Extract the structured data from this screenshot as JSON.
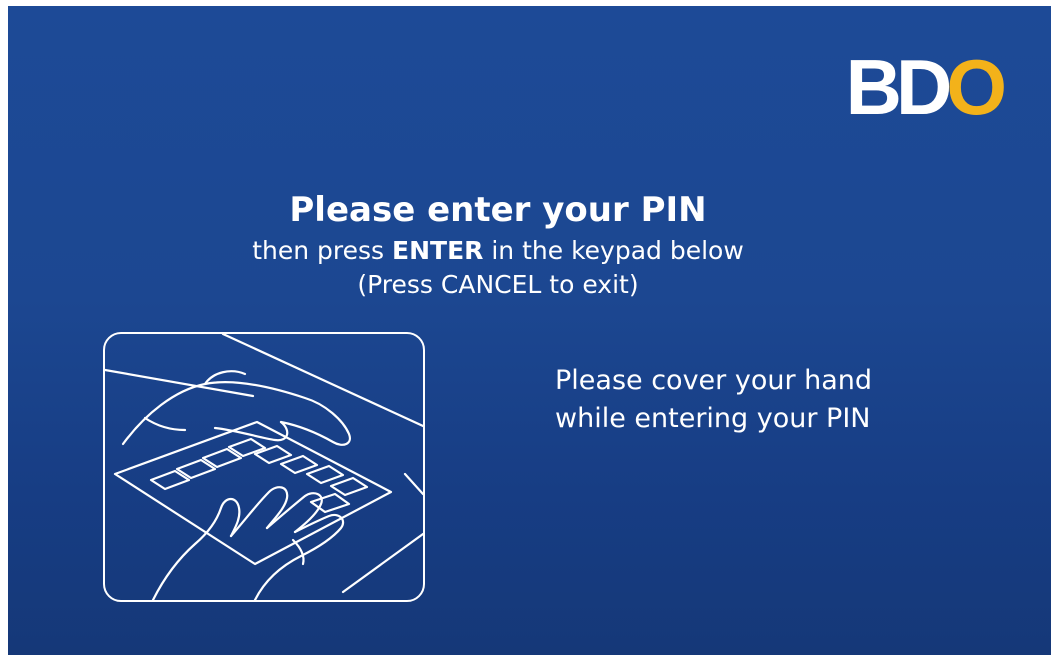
{
  "brand": {
    "logo_text_main": "BD",
    "logo_text_accent": "O",
    "primary_color": "#1c4791",
    "accent_color": "#f3b21a"
  },
  "prompt": {
    "title": "Please enter your PIN",
    "subtitle_pre": "then press ",
    "subtitle_key": "ENTER",
    "subtitle_post": " in the keypad below",
    "cancel_hint": "(Press CANCEL to exit)"
  },
  "security_note": {
    "line1": "Please cover your hand",
    "line2": "while entering your PIN",
    "icon": "hand-covering-keypad-icon"
  }
}
